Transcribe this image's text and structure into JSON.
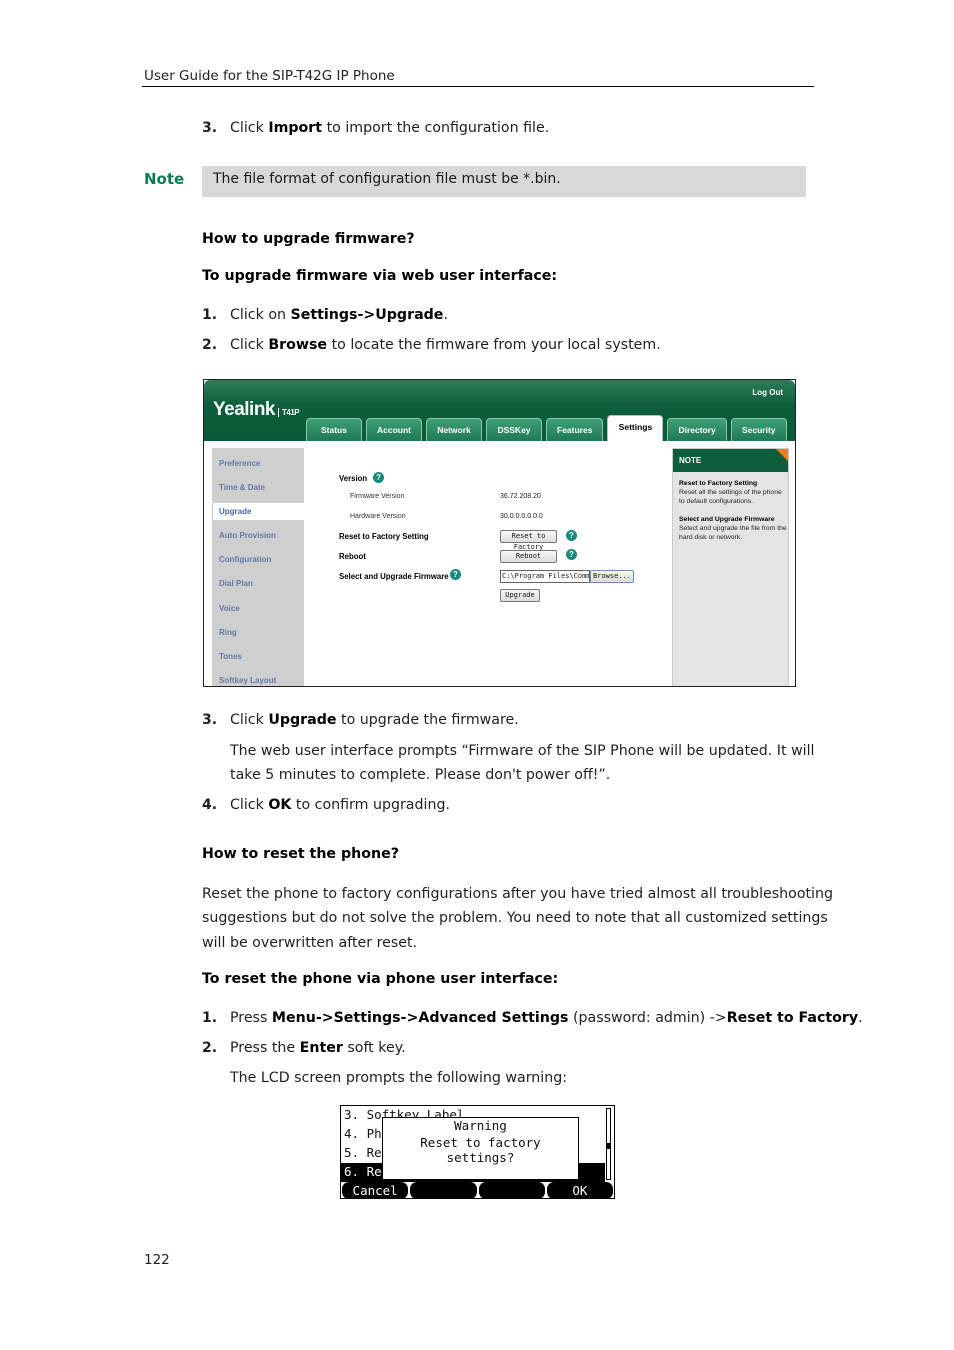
{
  "header": {
    "title": "User Guide for the SIP-T42G IP Phone"
  },
  "step_import": {
    "num": "3.",
    "pre": "Click ",
    "bold": "Import",
    "post": " to import the configuration file."
  },
  "note": {
    "label": "Note",
    "text": "The file format of configuration file must be *.bin."
  },
  "upgrade_section": {
    "heading": "How to upgrade firmware?",
    "subheading": "To upgrade firmware via web user interface:",
    "steps": [
      {
        "num": "1.",
        "pre": "Click on ",
        "bold": "Settings->Upgrade",
        "post": "."
      },
      {
        "num": "2.",
        "pre": "Click ",
        "bold": "Browse",
        "post": " to locate the firmware from your local system."
      }
    ]
  },
  "web_ui": {
    "logo": "Yealink",
    "model": "T41P",
    "logout": "Log Out",
    "tabs": [
      "Status",
      "Account",
      "Network",
      "DSSKey",
      "Features",
      "Settings",
      "Directory",
      "Security"
    ],
    "active_tab": "Settings",
    "sidebar": [
      "Preference",
      "Time & Date",
      "Upgrade",
      "Auto Provision",
      "Configuration",
      "Dial Plan",
      "Voice",
      "Ring",
      "Tones",
      "Softkey Layout"
    ],
    "active_sidebar": "Upgrade",
    "form": {
      "version_label": "Version",
      "firmware_label": "Firmware Version",
      "firmware_value": "36.72.208.20",
      "hardware_label": "Hardware Version",
      "hardware_value": "30.0.0.0.0.0.0",
      "reset_label": "Reset to Factory Setting",
      "reset_button": "Reset to Factory",
      "reboot_label": "Reboot",
      "reboot_button": "Reboot",
      "upgrade_label": "Select and Upgrade Firmware",
      "file_value": "C:\\Program Files\\Comm",
      "browse_button": "Browse...",
      "upgrade_button": "Upgrade",
      "help_glyph": "?"
    },
    "note_panel": {
      "title": "NOTE",
      "items": [
        {
          "title": "Reset to Factory Setting",
          "text": "Reset all the settings of the phone to default configurations."
        },
        {
          "title": "Select and Upgrade Firmware",
          "text": "Select and upgrade the file from the hard disk or network."
        }
      ]
    }
  },
  "upgrade_steps_2": [
    {
      "num": "3.",
      "pre": "Click ",
      "bold": "Upgrade",
      "post": " to upgrade the firmware."
    },
    {
      "num": "4.",
      "pre": "Click ",
      "bold": "OK",
      "post": " to confirm upgrading."
    }
  ],
  "upgrade_prompt_line1": "The web user interface prompts “Firmware of the SIP Phone will be updated. It will",
  "upgrade_prompt_line2": "take 5 minutes to complete. Please don't power off!”.",
  "reset_section": {
    "heading": "How to reset the phone?",
    "para_lines": [
      "Reset the phone to factory configurations after you have tried almost all troubleshooting",
      "suggestions but do not solve the problem. You need to note that all customized settings",
      "will be overwritten after reset."
    ],
    "subheading": "To reset the phone via phone user interface:",
    "step1": {
      "num": "1.",
      "p1": "Press ",
      "b1": "Menu",
      "p2": "->",
      "b2": "Settings",
      "p3": "->",
      "b3": "Advanced Settings",
      "p4": " (password: admin) ->",
      "b4": "Reset to Factory",
      "p5": "."
    },
    "step2": {
      "num": "2.",
      "pre": "Press the ",
      "bold": "Enter",
      "post": " soft key."
    },
    "lcd_intro": "The LCD screen prompts the following warning:"
  },
  "lcd": {
    "rows": [
      "3. Softkey Label",
      "4. Ph",
      "5. Re",
      "6. Re"
    ],
    "dialog_title": "Warning",
    "dialog_message": "Reset to factory settings?",
    "softkeys": [
      "Cancel",
      "",
      "",
      "OK"
    ]
  },
  "page_number": "122"
}
